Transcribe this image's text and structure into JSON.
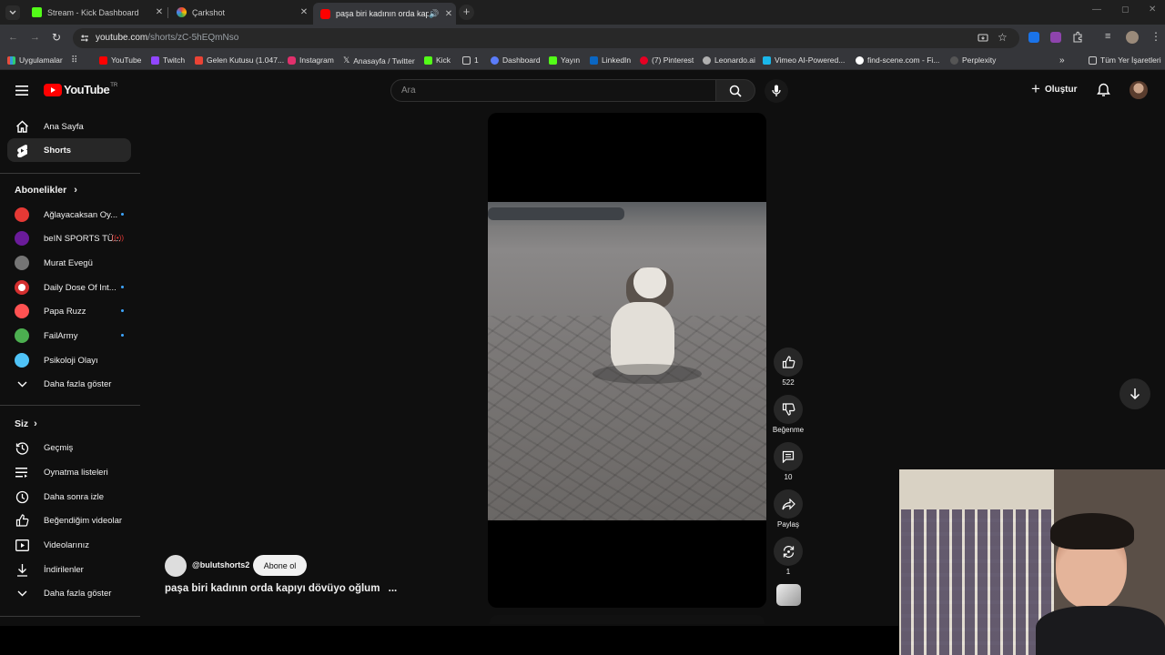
{
  "browser": {
    "tabs": [
      {
        "title": "Stream - Kick Dashboard",
        "favicon_color": "#53fc18"
      },
      {
        "title": "Çarkshot",
        "favicon_color": "#f4b400"
      },
      {
        "title": "paşa biri kadının orda kapıyı",
        "favicon_color": "#ff0000"
      }
    ],
    "url_host": "youtube.com",
    "url_path": "/shorts/zC-5hEQmNso",
    "bookmarks": [
      {
        "label": "Uygulamalar",
        "color": "#9aa0a6"
      },
      {
        "label": "YouTube",
        "color": "#ff0000"
      },
      {
        "label": "Twitch",
        "color": "#9146ff"
      },
      {
        "label": "Gelen Kutusu (1.047...",
        "color": "#ea4335"
      },
      {
        "label": "Instagram",
        "color": "#e1306c"
      },
      {
        "label": "Anasayfa / Twitter",
        "color": "#ffffff"
      },
      {
        "label": "Kick",
        "color": "#53fc18"
      },
      {
        "label": "1",
        "color": "#9aa0a6"
      },
      {
        "label": "Dashboard",
        "color": "#5b7cfa"
      },
      {
        "label": "Yayın",
        "color": "#53fc18"
      },
      {
        "label": "LinkedIn",
        "color": "#0a66c2"
      },
      {
        "label": "(7) Pinterest",
        "color": "#e60023"
      },
      {
        "label": "Leonardo.ai",
        "color": "#b0b0b0"
      },
      {
        "label": "Vimeo AI-Powered...",
        "color": "#1ab7ea"
      },
      {
        "label": "find-scene.com - Fi...",
        "color": "#ffffff"
      },
      {
        "label": "Perplexity",
        "color": "#cccccc"
      }
    ],
    "all_bookmarks": "Tüm Yer İşaretleri"
  },
  "youtube": {
    "logo_text": "YouTube",
    "logo_badge": "TR",
    "search_placeholder": "Ara",
    "create_label": "Oluştur",
    "nav": [
      {
        "label": "Ana Sayfa",
        "icon": "home-icon"
      },
      {
        "label": "Shorts",
        "icon": "shorts-icon"
      }
    ],
    "subscriptions_title": "Abonelikler",
    "subscriptions": [
      {
        "label": "Ağlayacaksan Oy...",
        "color": "#e53935",
        "dot": true
      },
      {
        "label": "beIN SPORTS TÜ...",
        "color": "#6a1b9a",
        "dot": true
      },
      {
        "label": "Murat Evegü",
        "color": "#757575",
        "dot": false
      },
      {
        "label": "Daily Dose Of Int...",
        "color": "#ffffff",
        "dot": true
      },
      {
        "label": "Papa Ruzz",
        "color": "#ff5252",
        "dot": true
      },
      {
        "label": "FailArmy",
        "color": "#4caf50",
        "dot": true
      },
      {
        "label": "Psikoloji Olayı",
        "color": "#4fc3f7",
        "dot": false
      }
    ],
    "show_more": "Daha fazla göster",
    "you_title": "Siz",
    "you_items": [
      {
        "label": "Geçmiş",
        "icon": "history-icon"
      },
      {
        "label": "Oynatma listeleri",
        "icon": "playlist-icon"
      },
      {
        "label": "Daha sonra izle",
        "icon": "clock-icon"
      },
      {
        "label": "Beğendiğim videolar",
        "icon": "like-icon"
      },
      {
        "label": "Videolarınız",
        "icon": "video-icon"
      },
      {
        "label": "İndirilenler",
        "icon": "download-icon"
      }
    ],
    "show_more_2": "Daha fazla göster",
    "short": {
      "channel": "@bulutshorts2",
      "subscribe": "Abone ol",
      "title": "paşa biri kadının orda kapıyı dövüyo oğlum",
      "more": "...",
      "likes": "522",
      "dislike_label": "Beğenme",
      "comments": "10",
      "share_label": "Paylaş",
      "remix": "1"
    }
  }
}
